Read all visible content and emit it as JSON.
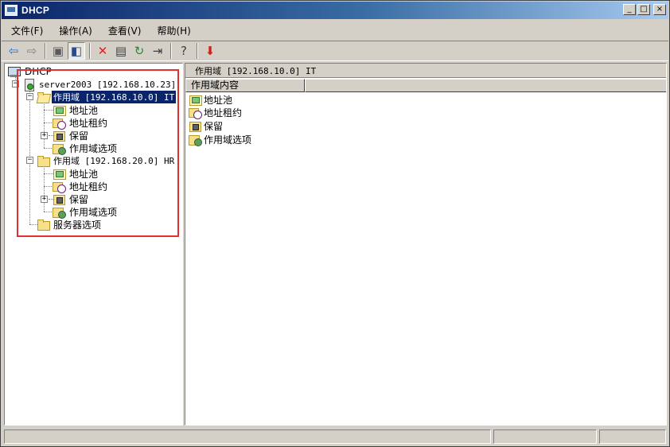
{
  "window": {
    "title": "DHCP"
  },
  "title_buttons": {
    "minimize": "_",
    "maximize": "□",
    "close": "×"
  },
  "menu": [
    "文件(F)",
    "操作(A)",
    "查看(V)",
    "帮助(H)"
  ],
  "toolbar": [
    {
      "name": "back-arrow-icon",
      "glyph": "⇦",
      "color": "#1f6fd6"
    },
    {
      "name": "forward-arrow-icon",
      "glyph": "⇨",
      "color": "#808080"
    },
    {
      "name": "up-level-icon",
      "glyph": "▣",
      "color": "#5a5a5a"
    },
    {
      "name": "show-hide-tree-icon",
      "glyph": "◧",
      "color": "#2a4a8a"
    },
    {
      "name": "delete-icon",
      "glyph": "✕",
      "color": "#e02020"
    },
    {
      "name": "properties-icon",
      "glyph": "▤",
      "color": "#404040"
    },
    {
      "name": "refresh-icon",
      "glyph": "↻",
      "color": "#2a8a2a"
    },
    {
      "name": "export-list-icon",
      "glyph": "⇥",
      "color": "#404040"
    },
    {
      "name": "help-icon",
      "glyph": "?",
      "color": "#404040"
    },
    {
      "name": "stop-service-icon",
      "glyph": "⬇",
      "color": "#d02020"
    }
  ],
  "tree": {
    "root": "DHCP",
    "server": "server2003 [192.168.10.23]",
    "scope1": {
      "label": "作用域 [192.168.10.0] IT",
      "children": [
        "地址池",
        "地址租约",
        "保留",
        "作用域选项"
      ]
    },
    "scope2": {
      "label": "作用域 [192.168.20.0] HR",
      "children": [
        "地址池",
        "地址租约",
        "保留",
        "作用域选项"
      ]
    },
    "server_options": "服务器选项"
  },
  "right_pane": {
    "header": "作用域 [192.168.10.0] IT",
    "column": "作用域内容",
    "items": [
      "地址池",
      "地址租约",
      "保留",
      "作用域选项"
    ]
  },
  "colors": {
    "selection": "#0a246a",
    "highlight_box": "#e03030",
    "title_bar": "#0a246a"
  }
}
